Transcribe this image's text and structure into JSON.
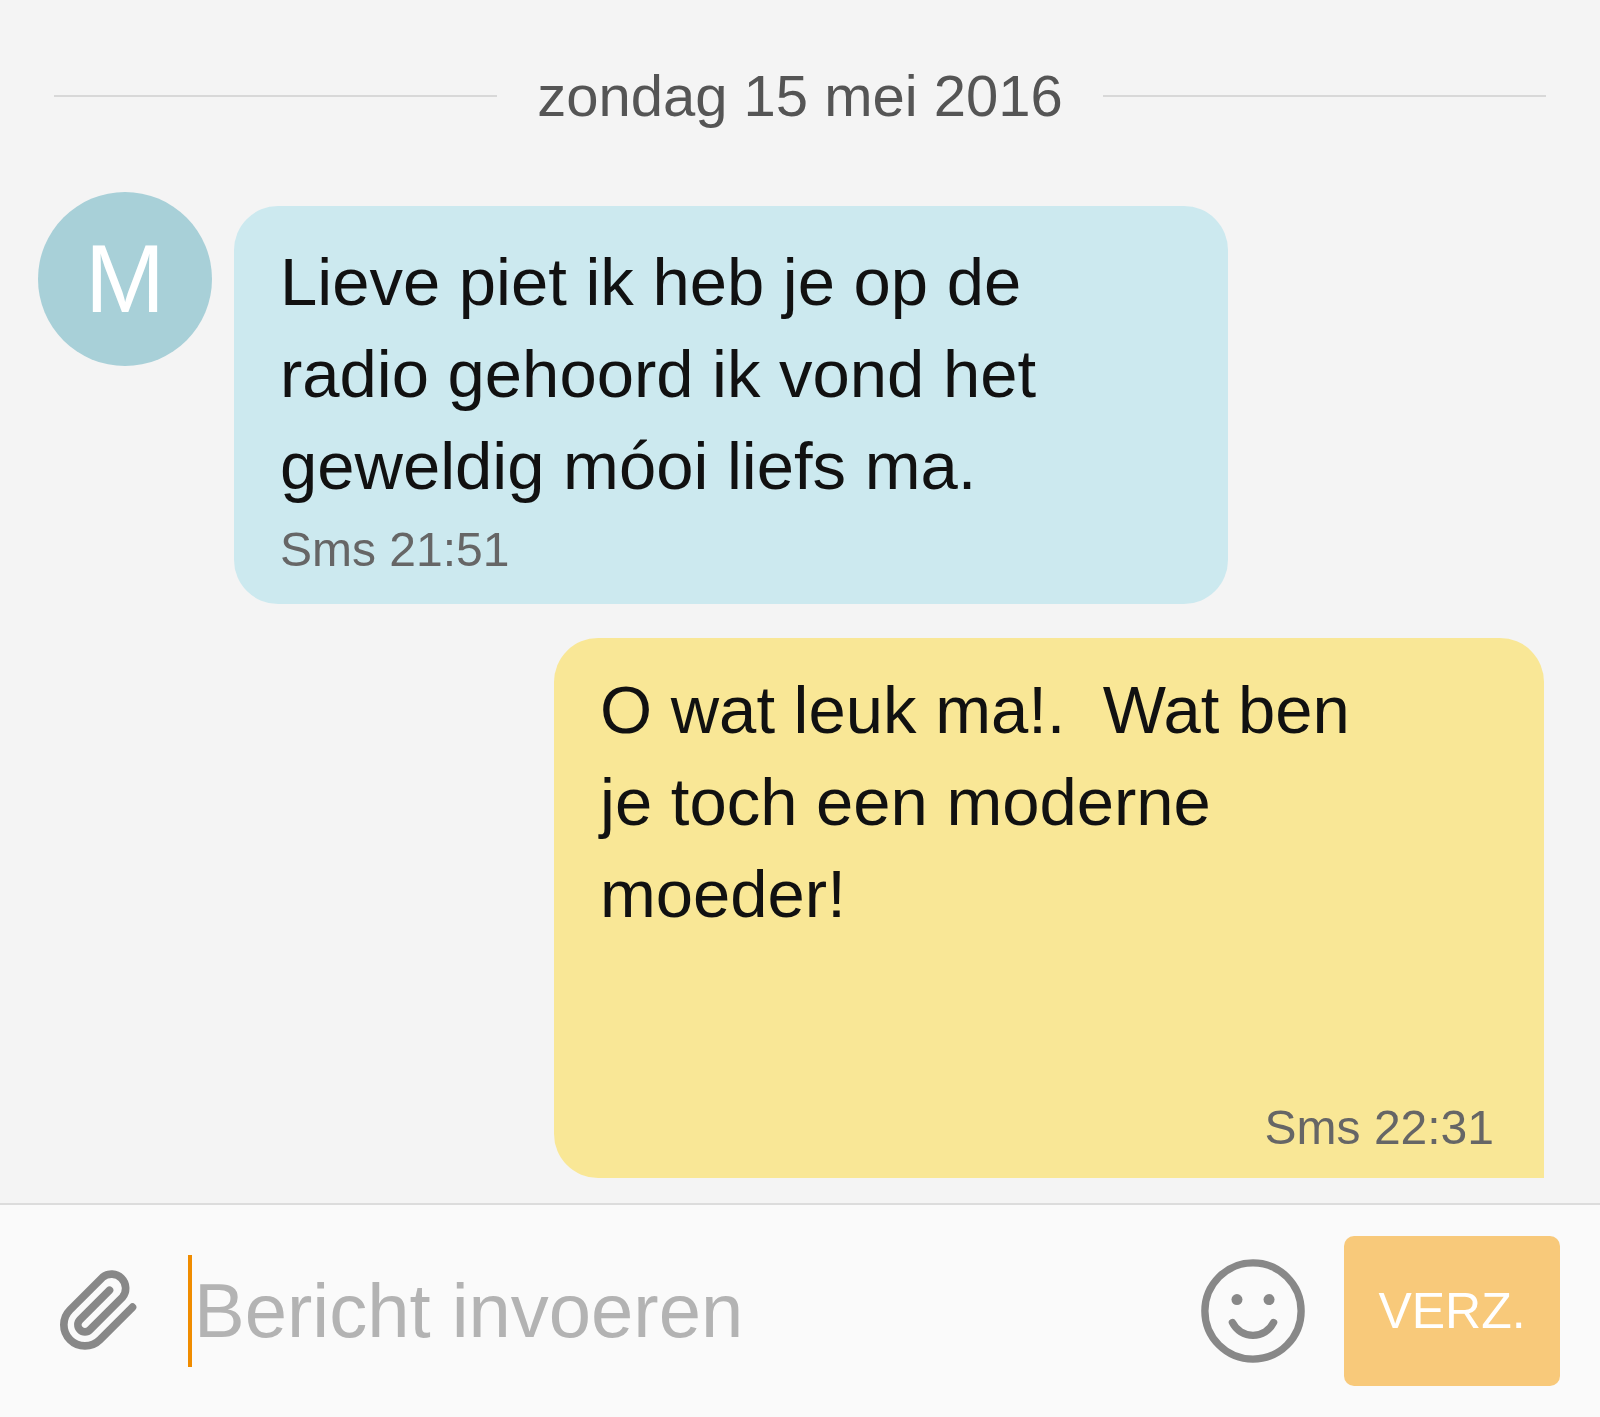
{
  "date_divider": "zondag 15 mei 2016",
  "messages": [
    {
      "kind": "incoming",
      "avatar": "M",
      "text": "Lieve piet ik heb je op de radio gehoord ik vond het geweldig móoi liefs ma.",
      "meta": "Sms 21:51"
    },
    {
      "kind": "outgoing",
      "text": "O wat leuk ma!.  Wat ben je toch een moderne moeder!",
      "meta": "Sms 22:31"
    }
  ],
  "composer": {
    "placeholder": "Bericht invoeren",
    "send_label": "VERZ."
  }
}
